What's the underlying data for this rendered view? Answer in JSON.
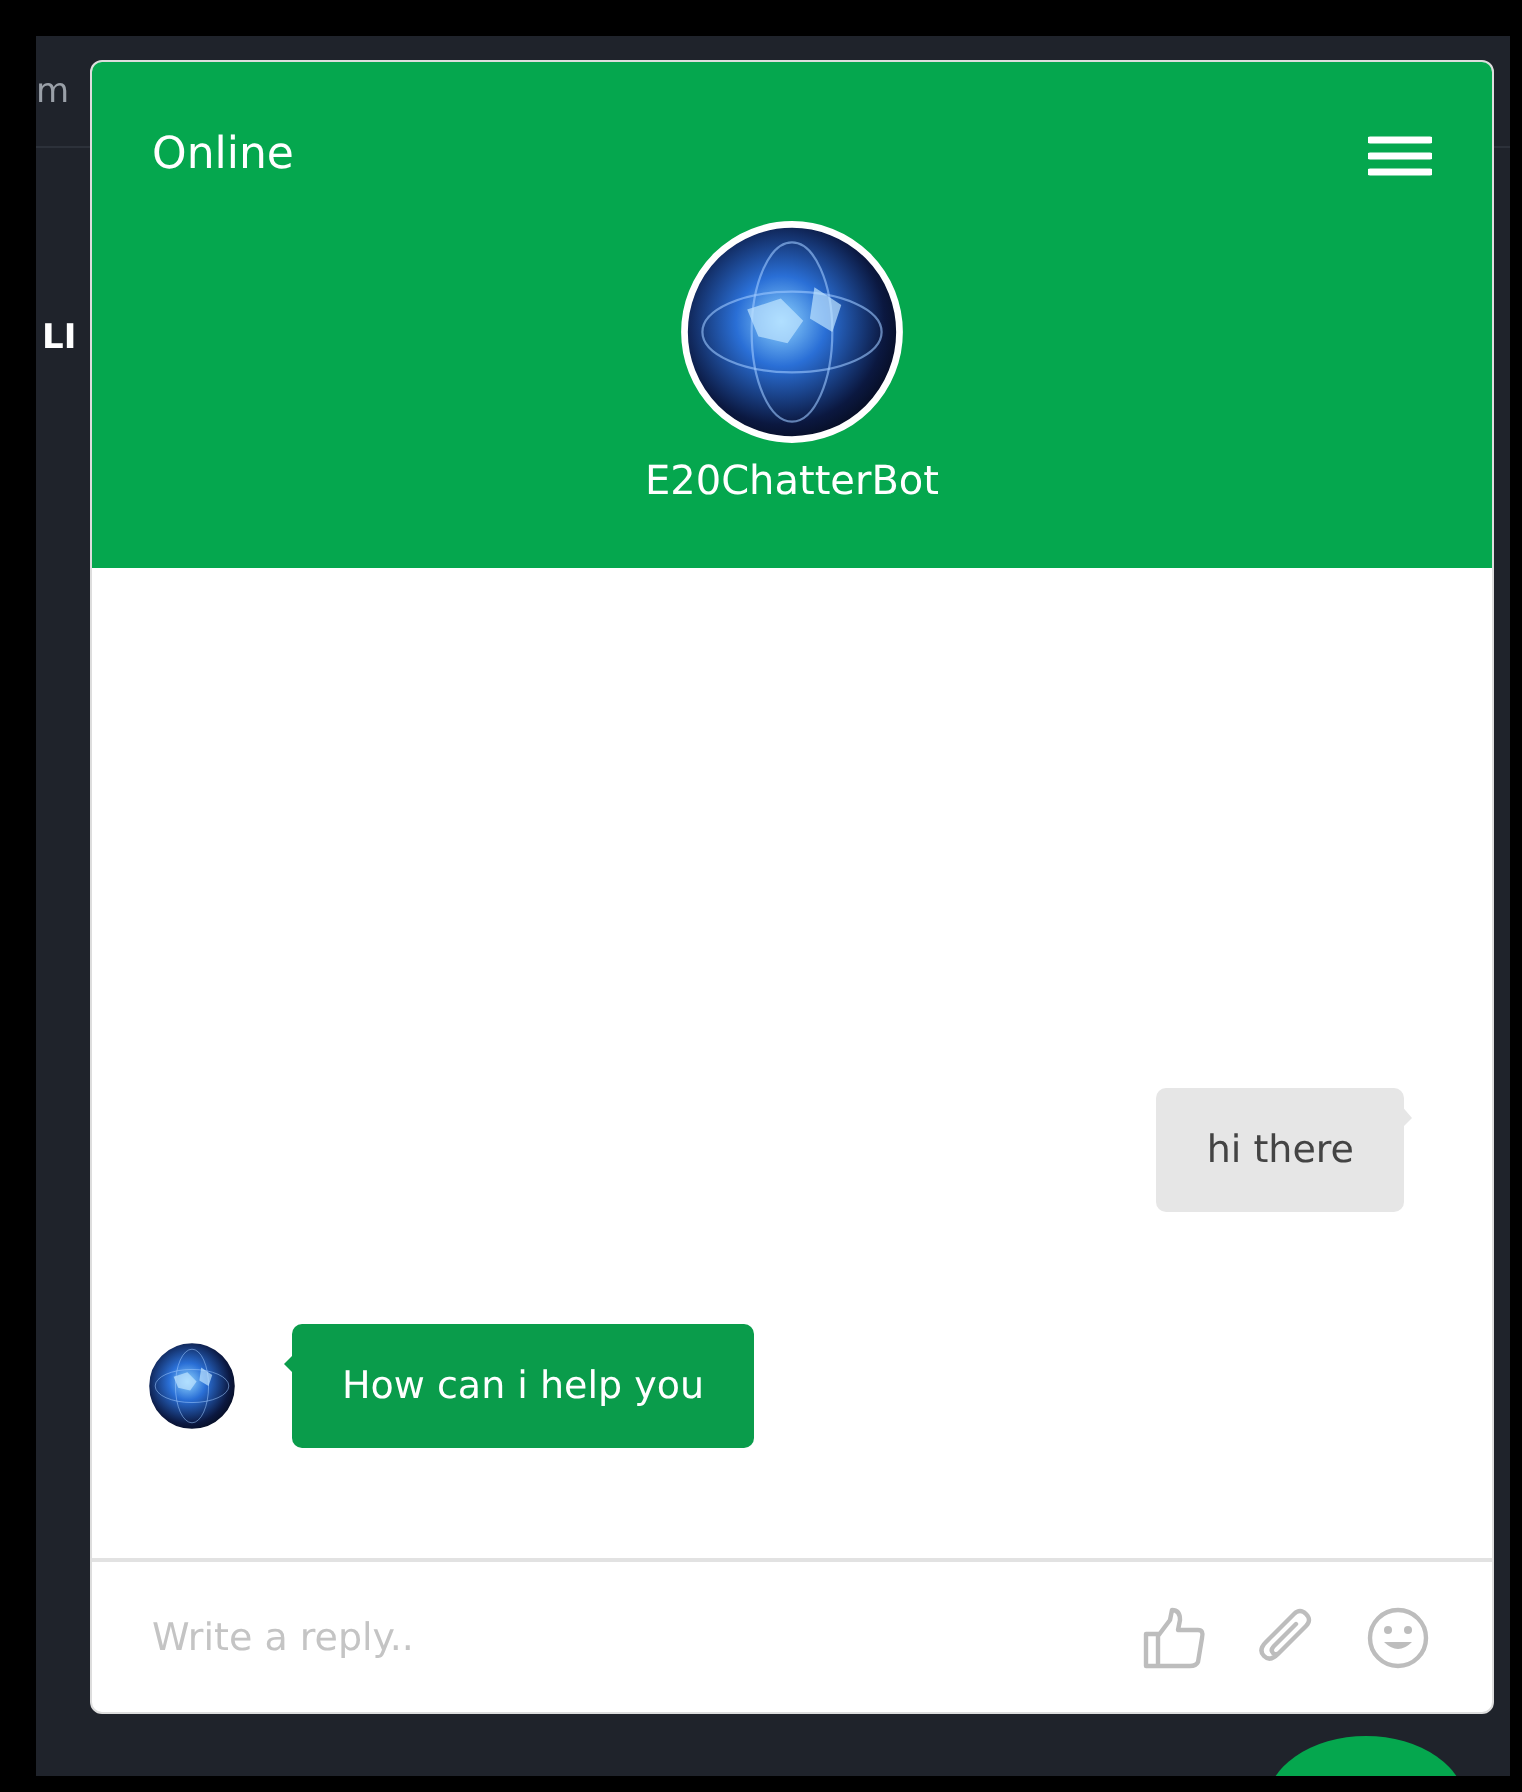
{
  "background": {
    "fragments": [
      "m",
      "LI"
    ]
  },
  "widget": {
    "status": "Online",
    "bot_name": "E20ChatterBot",
    "messages": [
      {
        "kind": "outgoing",
        "text": "hi there"
      },
      {
        "kind": "incoming",
        "text": "How can i help you"
      }
    ],
    "composer": {
      "placeholder": "Write a reply.."
    }
  }
}
